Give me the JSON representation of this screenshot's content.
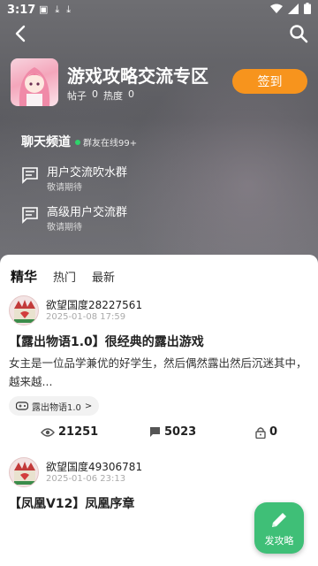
{
  "status_bar": {
    "time": "3:17"
  },
  "header": {
    "title": "游戏攻略交流专区",
    "posts_label": "帖子",
    "posts_count": "0",
    "heat_label": "热度",
    "heat_count": "0",
    "signin_label": "签到"
  },
  "chat": {
    "title": "聊天频道",
    "online_text": "群友在线99+",
    "groups": [
      {
        "name": "用户交流吹水群",
        "sub": "敬请期待"
      },
      {
        "name": "高级用户交流群",
        "sub": "敬请期待"
      }
    ]
  },
  "tabs": [
    {
      "label": "精华"
    },
    {
      "label": "热门"
    },
    {
      "label": "最新"
    }
  ],
  "posts": [
    {
      "author": "欲望国度28227561",
      "time": "2025-01-08 17:59",
      "title": "【露出物语1.0】很经典的露出游戏",
      "body": "女主是一位品学兼优的好学生，然后偶然露出然后沉迷其中，越来越...",
      "tag": "露出物语1.0",
      "tag_arrow": ">",
      "views": "21251",
      "comments": "5023",
      "locks": "0"
    },
    {
      "author": "欲望国度49306781",
      "time": "2025-01-06 23:13",
      "title": "【凤凰V12】凤凰序章"
    }
  ],
  "fab": {
    "label": "发攻略"
  },
  "colors": {
    "accent": "#f7941d",
    "fab": "#3fbf77",
    "online": "#2fd36b"
  }
}
